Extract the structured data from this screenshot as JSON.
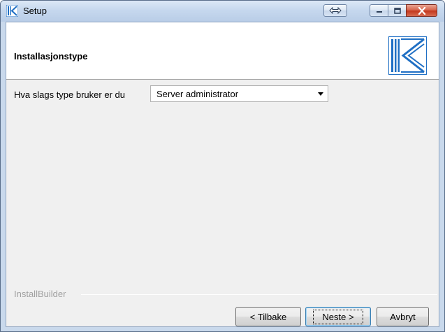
{
  "window": {
    "title": "Setup"
  },
  "header": {
    "page_title": "Installasjonstype"
  },
  "form": {
    "user_type_label": "Hva slags type bruker er du",
    "user_type_value": "Server administrator"
  },
  "footer": {
    "brand": "InstallBuilder",
    "back_label": "< Tilbake",
    "next_label": "Neste >",
    "cancel_label": "Avbryt"
  },
  "colors": {
    "logo_blue": "#1f6fc4",
    "close_red": "#c4391f"
  },
  "icons": {
    "app": "installbuilder-k-icon",
    "resize": "resize-arrows-icon",
    "minimize": "minimize-icon",
    "maximize": "maximize-icon",
    "close": "close-icon",
    "dropdown": "chevron-down-icon"
  }
}
